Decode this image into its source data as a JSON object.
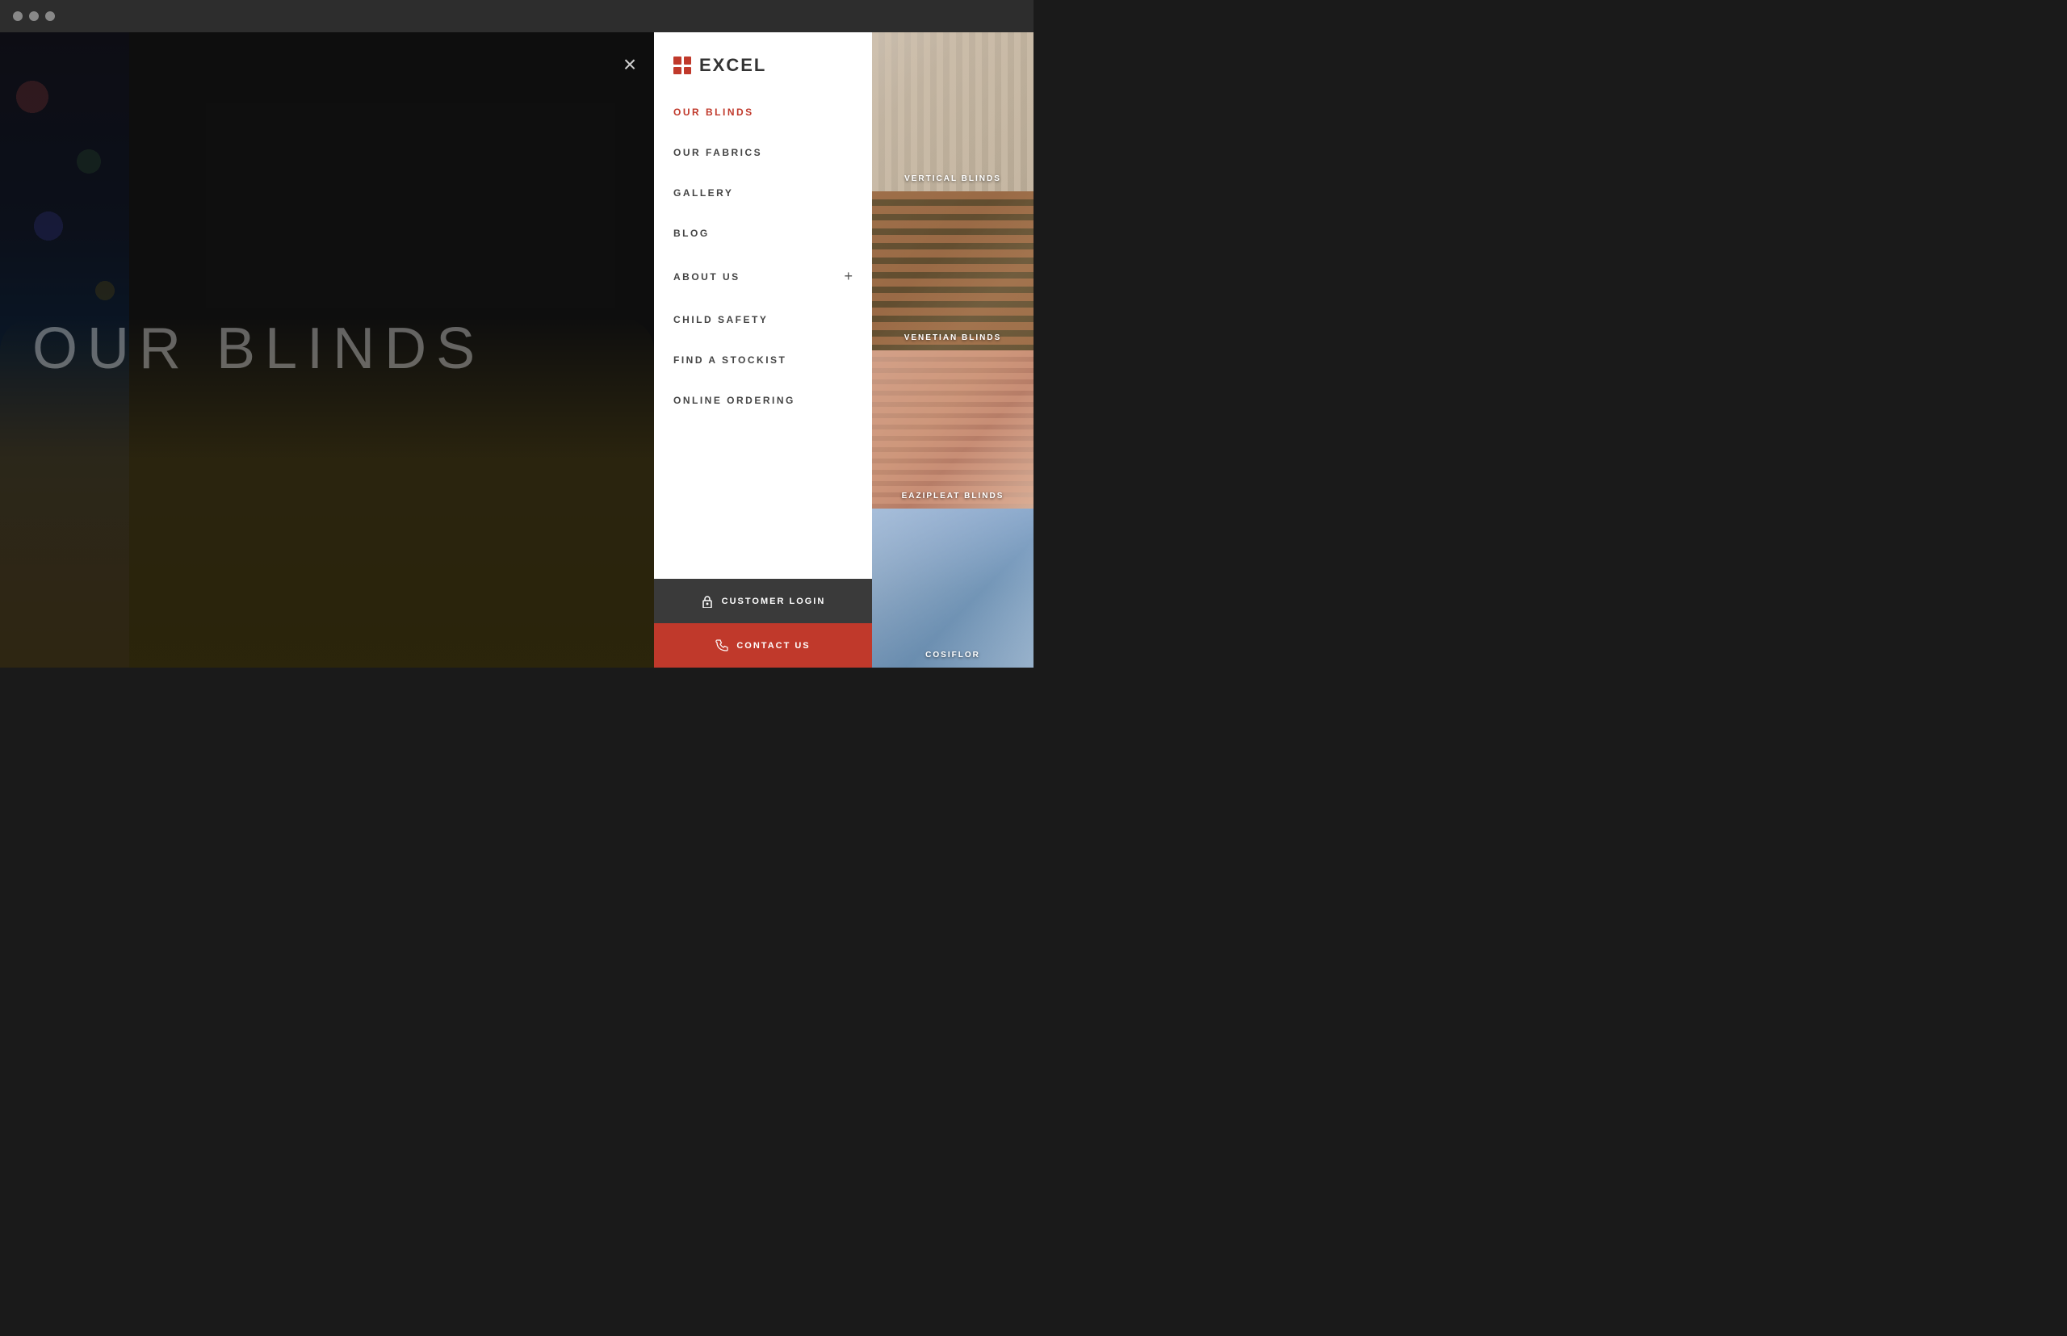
{
  "titlebar": {
    "traffic_lights": [
      "close",
      "minimize",
      "maximize"
    ]
  },
  "close_button": {
    "label": "×"
  },
  "logo": {
    "icon": "grid-icon",
    "text": "EXCEL"
  },
  "nav": {
    "items": [
      {
        "label": "OUR BLINDS",
        "active": true,
        "has_plus": false
      },
      {
        "label": "OUR FABRICS",
        "active": false,
        "has_plus": false
      },
      {
        "label": "GALLERY",
        "active": false,
        "has_plus": false
      },
      {
        "label": "BLOG",
        "active": false,
        "has_plus": false
      },
      {
        "label": "ABOUT US",
        "active": false,
        "has_plus": true
      },
      {
        "label": "CHILD SAFETY",
        "active": false,
        "has_plus": false
      },
      {
        "label": "FIND A STOCKIST",
        "active": false,
        "has_plus": false
      },
      {
        "label": "ONLINE ORDERING",
        "active": false,
        "has_plus": false
      }
    ]
  },
  "footer_buttons": {
    "login": {
      "label": "CUSTOMER LOGIN",
      "icon": "lock-icon"
    },
    "contact": {
      "label": "CONTACT US",
      "icon": "phone-icon"
    }
  },
  "hero": {
    "text": "OUR BLINDS"
  },
  "image_cards": [
    {
      "label": "VERTICAL BLINDS",
      "style": "vertical"
    },
    {
      "label": "VENETIAN BLINDS",
      "style": "venetian"
    },
    {
      "label": "EAZIPLEAT BLINDS",
      "style": "eazipleat"
    },
    {
      "label": "COSIFLOR",
      "style": "cosiflor"
    }
  ],
  "colors": {
    "accent": "#c0392b",
    "dark": "#3a3a3a",
    "white": "#ffffff",
    "nav_text": "#444444",
    "active_text": "#c0392b"
  }
}
